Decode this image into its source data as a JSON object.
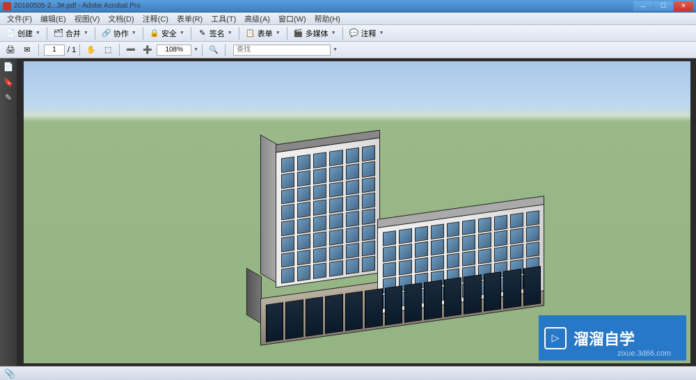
{
  "titlebar": {
    "filename": "20160505-2...3#.pdf",
    "app": "Adobe Acrobat Pro"
  },
  "menu": {
    "file": "文件(F)",
    "edit": "编辑(E)",
    "view": "视图(V)",
    "document": "文档(D)",
    "comment": "注释(C)",
    "forms": "表单(R)",
    "tools": "工具(T)",
    "advanced": "高级(A)",
    "window": "窗口(W)",
    "help": "帮助(H)"
  },
  "toolbar1": {
    "create": "创建",
    "combine": "合并",
    "collaborate": "协作",
    "secure": "安全",
    "sign": "签名",
    "forms": "表单",
    "multimedia": "多媒体",
    "comment": "注释"
  },
  "toolbar2": {
    "page_current": "1",
    "page_total": "/ 1",
    "zoom": "108%",
    "search_placeholder": "查找"
  },
  "watermark": {
    "brand": "溜溜自学",
    "url": "zixue.3d66.com"
  }
}
